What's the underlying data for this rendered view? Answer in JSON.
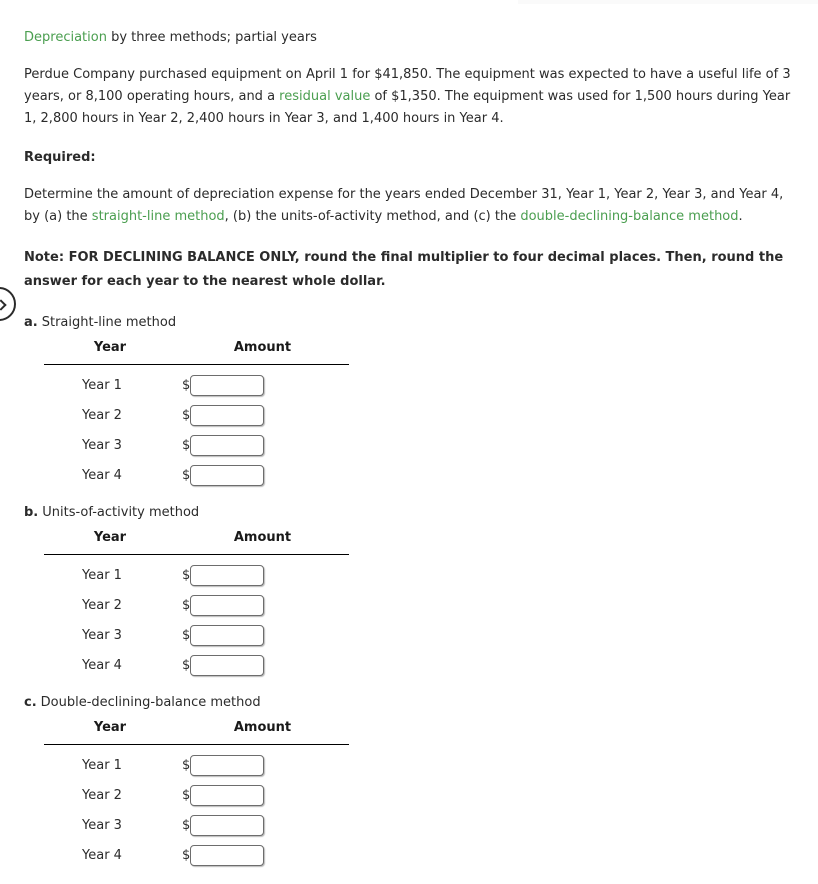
{
  "colors": {
    "link_green": "#4a9e4f",
    "text": "#2b2b2b",
    "rule": "#000000",
    "input_border": "#6d6d6d"
  },
  "header": {
    "title_link": "Depreciation",
    "title_rest": " by three methods; partial years"
  },
  "problem": {
    "text_1": "Perdue Company purchased equipment on April 1 for $41,850. The equipment was expected to have a useful life of 3 years, or 8,100 operating hours, and a ",
    "link_1": "residual value",
    "text_2": " of $1,350. The equipment was used for 1,500 hours during Year 1, 2,800 hours in Year 2, 2,400 hours in Year 3, and 1,400 hours in Year 4.",
    "required_label": "Required:",
    "instruction_1": "Determine the amount of depreciation expense for the years ended December 31, Year 1, Year 2, Year 3, and Year 4, by (a) the ",
    "instruction_link_1": "straight-line method",
    "instruction_2": ", (b) the units-of-activity method, and (c) the ",
    "instruction_link_2": "double-declining-balance method",
    "instruction_3": ".",
    "note": "Note: FOR DECLINING BALANCE ONLY, round the final multiplier to four decimal places. Then, round the answer for each year to the nearest whole dollar."
  },
  "nav": {
    "prev_icon": "chevron-left-icon"
  },
  "parts": [
    {
      "letter": "a.",
      "label": "Straight-line method",
      "columns": [
        "Year",
        "Amount"
      ],
      "currency_symbol": "$",
      "rows": [
        {
          "year": "Year 1",
          "amount": "",
          "placeholder": ""
        },
        {
          "year": "Year 2",
          "amount": "",
          "placeholder": ""
        },
        {
          "year": "Year 3",
          "amount": "",
          "placeholder": ""
        },
        {
          "year": "Year 4",
          "amount": "",
          "placeholder": ""
        }
      ]
    },
    {
      "letter": "b.",
      "label": "Units-of-activity method",
      "columns": [
        "Year",
        "Amount"
      ],
      "currency_symbol": "$",
      "rows": [
        {
          "year": "Year 1",
          "amount": "",
          "placeholder": ""
        },
        {
          "year": "Year 2",
          "amount": "",
          "placeholder": ""
        },
        {
          "year": "Year 3",
          "amount": "",
          "placeholder": ""
        },
        {
          "year": "Year 4",
          "amount": "",
          "placeholder": ""
        }
      ]
    },
    {
      "letter": "c.",
      "label": "Double-declining-balance method",
      "columns": [
        "Year",
        "Amount"
      ],
      "currency_symbol": "$",
      "rows": [
        {
          "year": "Year 1",
          "amount": "",
          "placeholder": ""
        },
        {
          "year": "Year 2",
          "amount": "",
          "placeholder": ""
        },
        {
          "year": "Year 3",
          "amount": "",
          "placeholder": ""
        },
        {
          "year": "Year 4",
          "amount": "",
          "placeholder": ""
        }
      ]
    }
  ]
}
